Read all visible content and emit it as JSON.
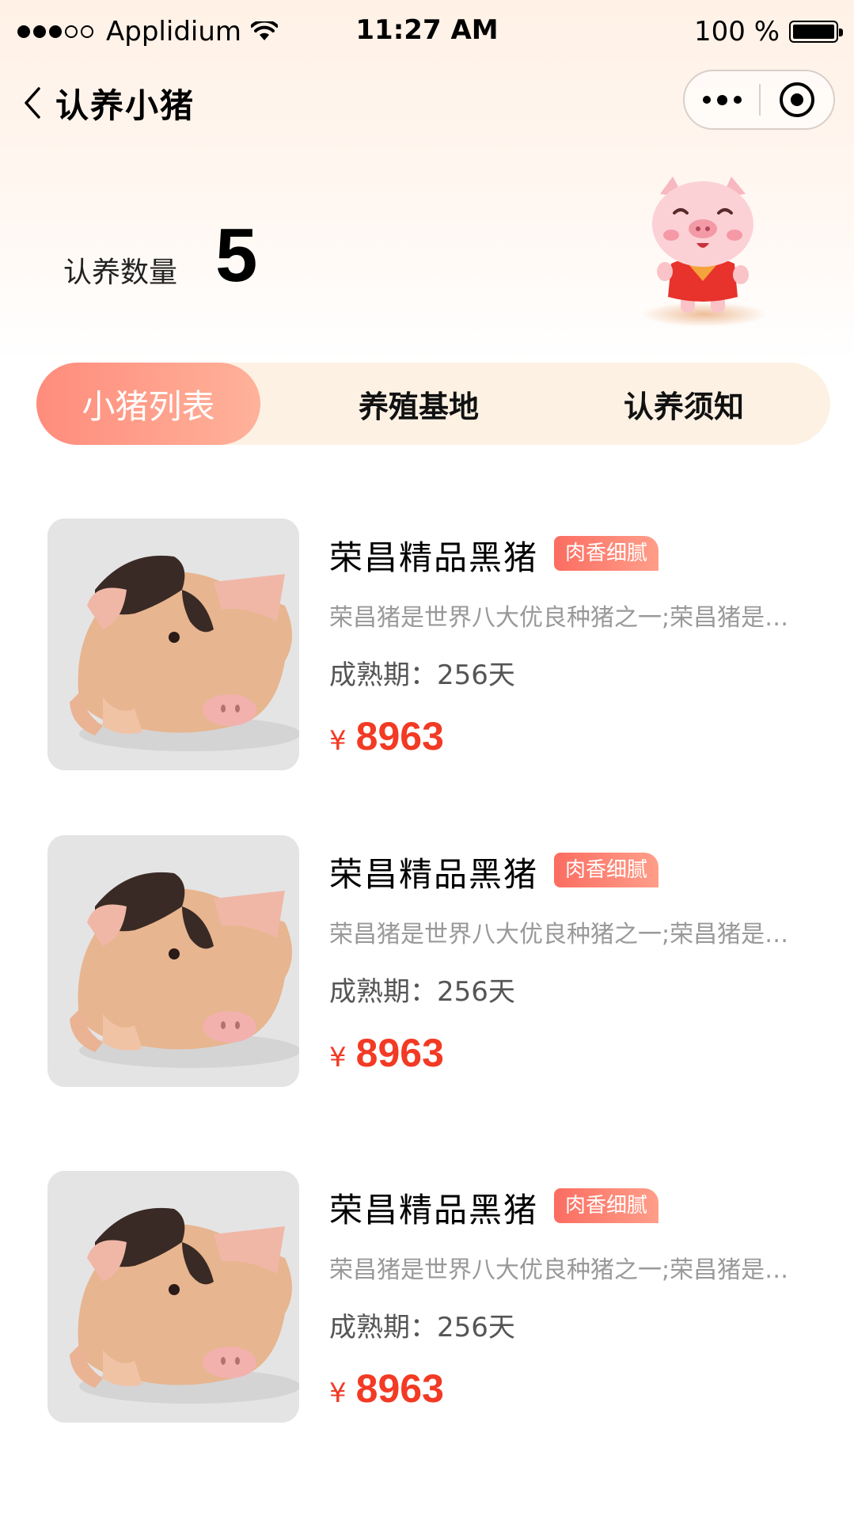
{
  "status_bar": {
    "carrier": "Applidium",
    "time": "11:27 AM",
    "battery": "100 %"
  },
  "nav": {
    "title": "认养小猪"
  },
  "summary": {
    "label": "认养数量",
    "count": "5"
  },
  "tabs": [
    {
      "label": "小猪列表",
      "active": true
    },
    {
      "label": "养殖基地",
      "active": false
    },
    {
      "label": "认养须知",
      "active": false
    }
  ],
  "products": [
    {
      "name": "荣昌精品黑猪",
      "tag": "肉香细腻",
      "description": "荣昌猪是世界八大优良种猪之一;荣昌猪是世界八大优良种猪之一",
      "period": "成熟期：256天",
      "currency": "¥",
      "price": "8963"
    },
    {
      "name": "荣昌精品黑猪",
      "tag": "肉香细腻",
      "description": "荣昌猪是世界八大优良种猪之一;荣昌猪是世界八大优良种猪之一",
      "period": "成熟期：256天",
      "currency": "¥",
      "price": "8963"
    },
    {
      "name": "荣昌精品黑猪",
      "tag": "肉香细腻",
      "description": "荣昌猪是世界八大优良种猪之一;荣昌猪是世界八大优良种猪之一",
      "period": "成熟期：256天",
      "currency": "¥",
      "price": "8963"
    }
  ],
  "colors": {
    "accent": "#f23a24",
    "tab_active_start": "#ff8c7c",
    "tab_active_end": "#ffb29a",
    "tab_bar_bg": "#fdf1e4"
  },
  "icons": {
    "back": "chevron-left-icon",
    "more": "more-dots-icon",
    "close": "target-circle-icon",
    "wifi": "wifi-icon",
    "battery": "battery-icon"
  }
}
